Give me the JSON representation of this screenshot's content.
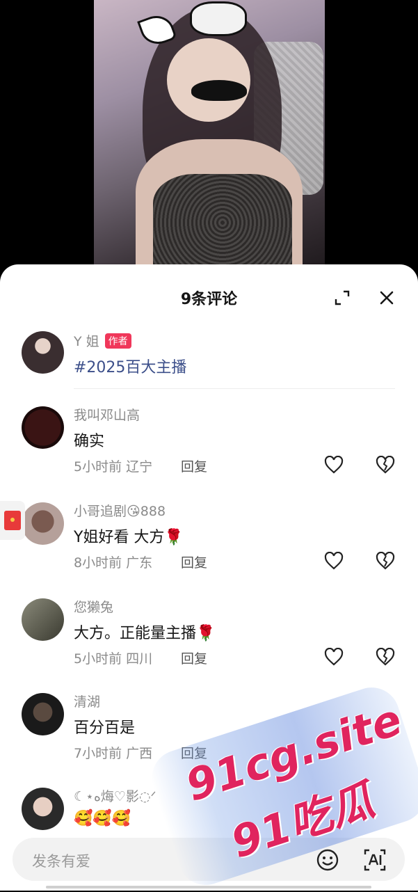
{
  "header": {
    "title": "9条评论"
  },
  "comments": [
    {
      "name": "Y 姐",
      "badge": "作者",
      "text": "#2025百大主播"
    },
    {
      "name": "我叫邓山高",
      "text": "确实",
      "time_location": "5小时前 辽宁",
      "reply_label": "回复"
    },
    {
      "name": "小哥追剧😘888",
      "text": "Y姐好看 大方🌹",
      "time_location": "8小时前 广东",
      "reply_label": "回复"
    },
    {
      "name": "您獭兔",
      "text": "大方。正能量主播🌹",
      "time_location": "5小时前 四川",
      "reply_label": "回复"
    },
    {
      "name": "清湖",
      "text": "百分百是",
      "time_location": "7小时前 广西",
      "reply_label": "回复"
    },
    {
      "name": "☾⋆ه烸♡影◌ᐟ",
      "text": "🥰🥰🥰"
    }
  ],
  "input": {
    "placeholder": "发条有爱"
  },
  "watermark": {
    "line1": "91cg.site",
    "line2": "91吃瓜"
  },
  "colors": {
    "accent": "#f0375a",
    "hashtag": "#3c4f8a",
    "watermark": "#e0245e"
  }
}
